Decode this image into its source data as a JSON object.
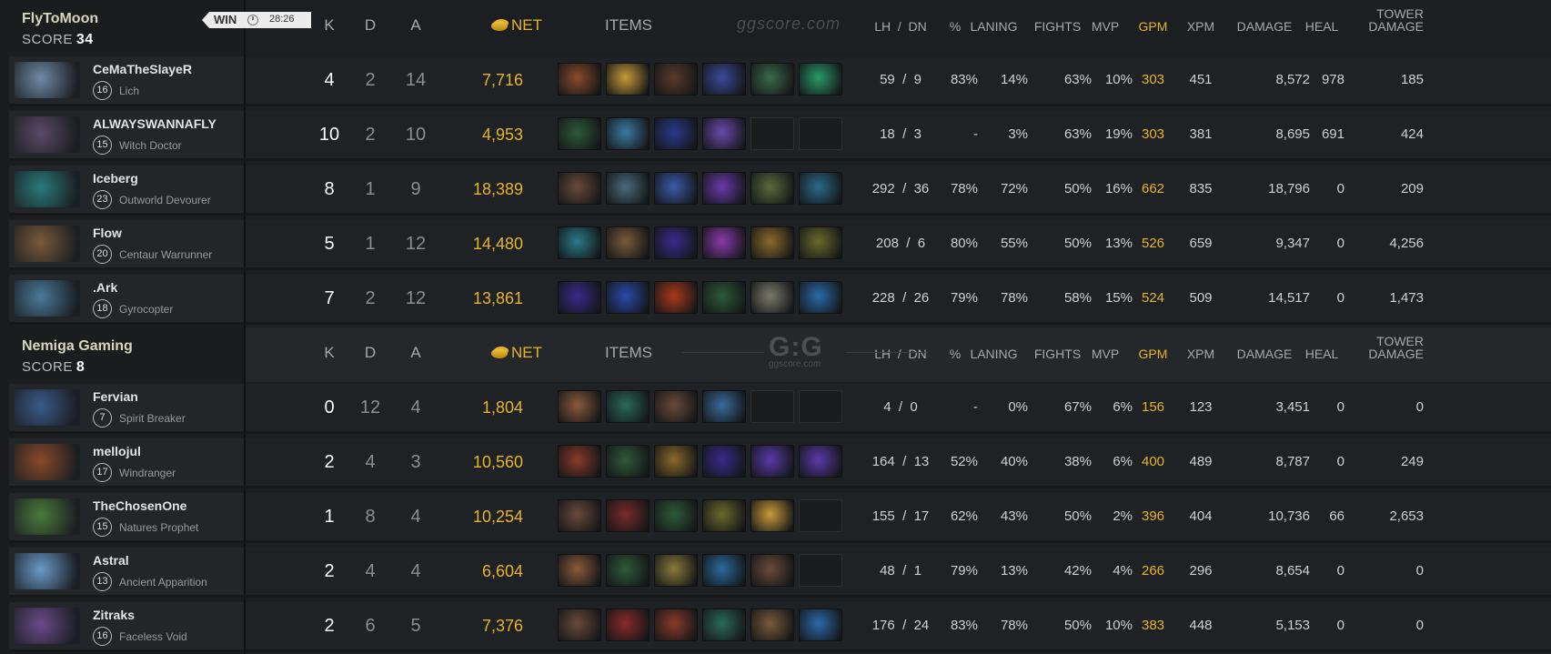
{
  "match": {
    "result": "WIN",
    "duration": "28:26"
  },
  "headers": {
    "k": "K",
    "d": "D",
    "a": "A",
    "net": "NET",
    "items": "ITEMS",
    "lh_dn": "LH  /  DN",
    "pct": "%",
    "laning": "LANING",
    "fights": "FIGHTS",
    "mvp": "MVP",
    "gpm": "GPM",
    "xpm": "XPM",
    "damage": "DAMAGE",
    "heal": "HEAL",
    "tower_damage_1": "TOWER",
    "tower_damage_2": "DAMAGE"
  },
  "watermark": {
    "site": "ggscore.com",
    "logo": "G:G",
    "logo_sub": "ggscore.com"
  },
  "teams": [
    {
      "name": "FlyToMoon",
      "score_label": "SCORE",
      "score": "34",
      "players": [
        {
          "name": "CeMaTheSlayeR",
          "level": "16",
          "hero": "Lich",
          "portrait_color": "#6f8aa6",
          "k": "4",
          "d": "2",
          "a": "14",
          "net": "7,716",
          "items": [
            "#8a4b2a",
            "#c89a3a",
            "#5a3a2a",
            "#3a4a9a",
            "#3a6a4a",
            "#2a9a6a"
          ],
          "lh": "59",
          "dn": "9",
          "pct": "83%",
          "laning": "14%",
          "fights": "63%",
          "mvp": "10%",
          "gpm": "303",
          "xpm": "451",
          "damage": "8,572",
          "heal": "978",
          "tower": "185"
        },
        {
          "name": "ALWAYSWANNAFLY",
          "level": "15",
          "hero": "Witch Doctor",
          "portrait_color": "#5a4a66",
          "k": "10",
          "d": "2",
          "a": "10",
          "net": "4,953",
          "items": [
            "#2e5a3a",
            "#3a7aa0",
            "#2a3a8a",
            "#6a4aaa",
            "",
            ""
          ],
          "lh": "18",
          "dn": "3",
          "pct": "-",
          "laning": "3%",
          "fights": "63%",
          "mvp": "19%",
          "gpm": "303",
          "xpm": "381",
          "damage": "8,695",
          "heal": "691",
          "tower": "424"
        },
        {
          "name": "Iceberg",
          "level": "23",
          "hero": "Outworld Devourer",
          "portrait_color": "#2a7a7a",
          "k": "8",
          "d": "1",
          "a": "9",
          "net": "18,389",
          "items": [
            "#6a4a3a",
            "#4a6a7a",
            "#3a5aaa",
            "#6a3aaa",
            "#5a6a3a",
            "#2a6a8a"
          ],
          "lh": "292",
          "dn": "36",
          "pct": "78%",
          "laning": "72%",
          "fights": "50%",
          "mvp": "16%",
          "gpm": "662",
          "xpm": "835",
          "damage": "18,796",
          "heal": "0",
          "tower": "209"
        },
        {
          "name": "Flow",
          "level": "20",
          "hero": "Centaur Warrunner",
          "portrait_color": "#7a5a3a",
          "k": "5",
          "d": "1",
          "a": "12",
          "net": "14,480",
          "items": [
            "#2a7a8a",
            "#7a5a3a",
            "#3a2a8a",
            "#8a3aaa",
            "#8a6a2a",
            "#6a6a2a"
          ],
          "lh": "208",
          "dn": "6",
          "pct": "80%",
          "laning": "55%",
          "fights": "50%",
          "mvp": "13%",
          "gpm": "526",
          "xpm": "659",
          "damage": "9,347",
          "heal": "0",
          "tower": "4,256"
        },
        {
          "name": ".Ark",
          "level": "18",
          "hero": "Gyrocopter",
          "portrait_color": "#4a7a9a",
          "k": "7",
          "d": "2",
          "a": "12",
          "net": "13,861",
          "items": [
            "#3a2a8a",
            "#2a4aaa",
            "#aa3a1a",
            "#2e5a3a",
            "#7a7a6a",
            "#2a6aaa"
          ],
          "lh": "228",
          "dn": "26",
          "pct": "79%",
          "laning": "78%",
          "fights": "58%",
          "mvp": "15%",
          "gpm": "524",
          "xpm": "509",
          "damage": "14,517",
          "heal": "0",
          "tower": "1,473"
        }
      ]
    },
    {
      "name": "Nemiga Gaming",
      "score_label": "SCORE",
      "score": "8",
      "players": [
        {
          "name": "Fervian",
          "level": "7",
          "hero": "Spirit Breaker",
          "portrait_color": "#3a5a8a",
          "k": "0",
          "d": "12",
          "a": "4",
          "net": "1,804",
          "items": [
            "#8a5a3a",
            "#2a6a5a",
            "#6a4a3a",
            "#3a6a9a",
            "",
            ""
          ],
          "lh": "4",
          "dn": "0",
          "pct": "-",
          "laning": "0%",
          "fights": "67%",
          "mvp": "6%",
          "gpm": "156",
          "xpm": "123",
          "damage": "3,451",
          "heal": "0",
          "tower": "0"
        },
        {
          "name": "mellojul",
          "level": "17",
          "hero": "Windranger",
          "portrait_color": "#8a4a2a",
          "k": "2",
          "d": "4",
          "a": "3",
          "net": "10,560",
          "items": [
            "#8a3a2a",
            "#2e5a3a",
            "#8a6a2a",
            "#3a2a8a",
            "#5a3aaa",
            "#5a3aaa"
          ],
          "lh": "164",
          "dn": "13",
          "pct": "52%",
          "laning": "40%",
          "fights": "38%",
          "mvp": "6%",
          "gpm": "400",
          "xpm": "489",
          "damage": "8,787",
          "heal": "0",
          "tower": "249"
        },
        {
          "name": "TheChosenOne",
          "level": "15",
          "hero": "Natures Prophet",
          "portrait_color": "#4a7a3a",
          "k": "1",
          "d": "8",
          "a": "4",
          "net": "10,254",
          "items": [
            "#6a4a3a",
            "#7a2a2a",
            "#2e5a3a",
            "#6a6a2a",
            "#c89a3a",
            ""
          ],
          "lh": "155",
          "dn": "17",
          "pct": "62%",
          "laning": "43%",
          "fights": "50%",
          "mvp": "2%",
          "gpm": "396",
          "xpm": "404",
          "damage": "10,736",
          "heal": "66",
          "tower": "2,653"
        },
        {
          "name": "Astral",
          "level": "13",
          "hero": "Ancient Apparition",
          "portrait_color": "#6a9ac8",
          "k": "2",
          "d": "4",
          "a": "4",
          "net": "6,604",
          "items": [
            "#8a5a3a",
            "#2e5a3a",
            "#8a7a3a",
            "#2a6a9a",
            "#6a4a3a",
            ""
          ],
          "lh": "48",
          "dn": "1",
          "pct": "79%",
          "laning": "13%",
          "fights": "42%",
          "mvp": "4%",
          "gpm": "266",
          "xpm": "296",
          "damage": "8,654",
          "heal": "0",
          "tower": "0"
        },
        {
          "name": "Zitraks",
          "level": "16",
          "hero": "Faceless Void",
          "portrait_color": "#6a4a8a",
          "k": "2",
          "d": "6",
          "a": "5",
          "net": "7,376",
          "items": [
            "#6a4a3a",
            "#8a2a2a",
            "#8a3a2a",
            "#2a6a5a",
            "#7a5a3a",
            "#2a6aaa"
          ],
          "lh": "176",
          "dn": "24",
          "pct": "83%",
          "laning": "78%",
          "fights": "50%",
          "mvp": "10%",
          "gpm": "383",
          "xpm": "448",
          "damage": "5,153",
          "heal": "0",
          "tower": "0"
        }
      ]
    }
  ]
}
